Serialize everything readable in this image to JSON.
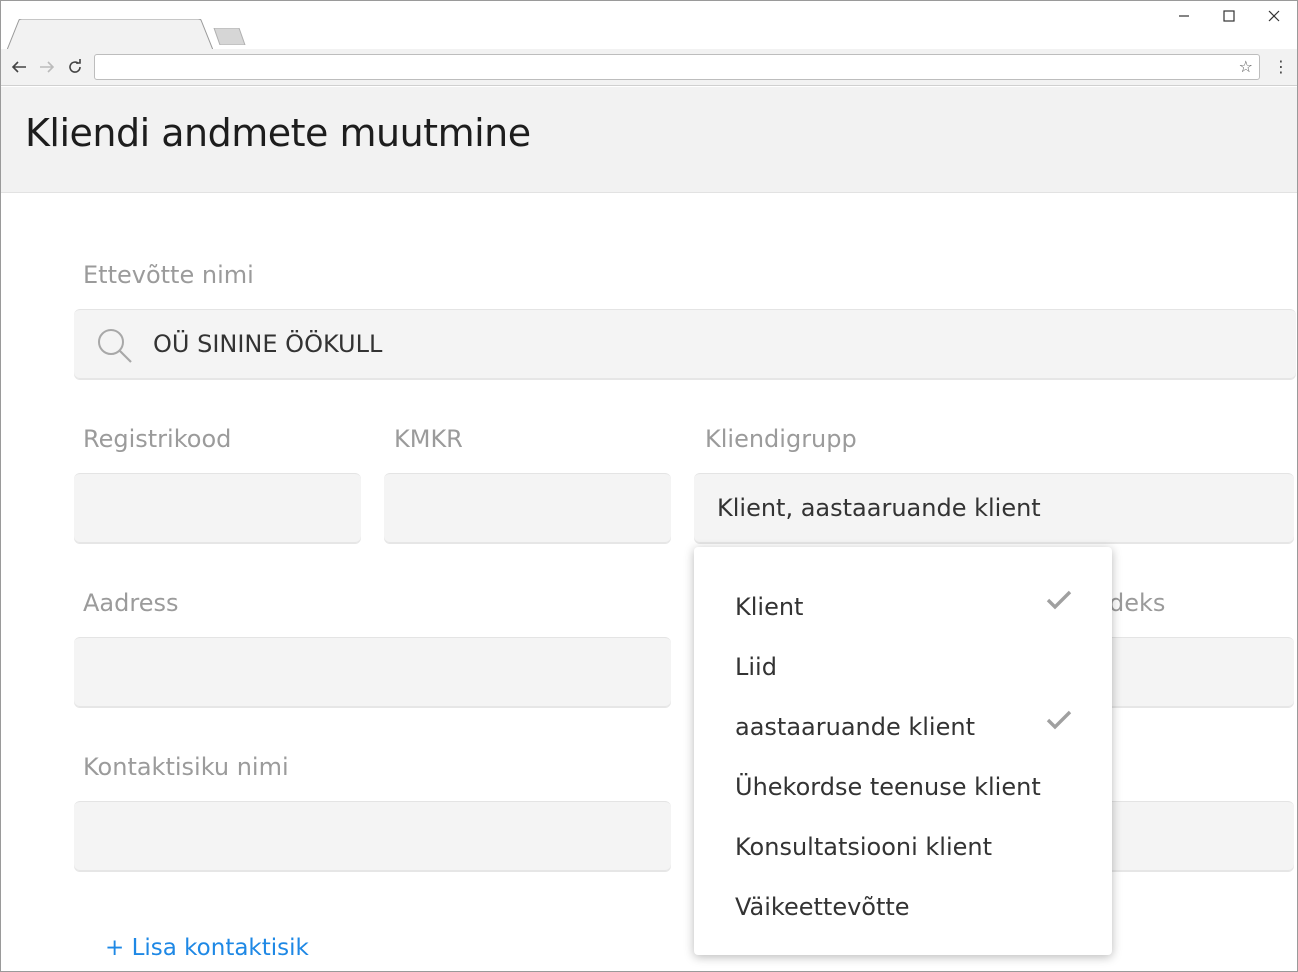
{
  "browser": {
    "url": "",
    "icons": {
      "back": "arrow-left-icon",
      "forward": "arrow-right-icon",
      "reload": "reload-icon",
      "bookmark": "star-icon",
      "menu": "kebab-menu-icon",
      "minimize": "minimize-icon",
      "maximize": "maximize-icon",
      "close": "close-icon"
    }
  },
  "page": {
    "title": "Kliendi andmete muutmine"
  },
  "form": {
    "company_label": "Ettevõtte nimi",
    "company_value": "OÜ SININE ÖÖKULL",
    "regcode_label": "Registrikood",
    "regcode_value": "",
    "vat_label": "KMKR",
    "vat_value": "",
    "group_label": "Kliendigrupp",
    "group_value": "Klient, aastaaruande klient",
    "address_label": "Aadress",
    "address_value": "",
    "postal_label_partial": "deks",
    "contact_label": "Kontaktisiku nimi",
    "contact_value": "",
    "add_contact": "+ Lisa kontaktisik"
  },
  "dropdown": {
    "options": [
      {
        "label": "Klient",
        "checked": true
      },
      {
        "label": "Liid",
        "checked": false
      },
      {
        "label": "aastaaruande klient",
        "checked": true
      },
      {
        "label": "Ühekordse teenuse klient",
        "checked": false
      },
      {
        "label": "Konsultatsiooni klient",
        "checked": false
      },
      {
        "label": "Väikeettevõtte",
        "checked": false
      }
    ],
    "check_icon": "checkmark-icon"
  },
  "colors": {
    "link": "#1e88e5",
    "label": "#9b9b9b",
    "header_bg": "#f2f2f2",
    "field_bg": "#f4f4f4"
  }
}
